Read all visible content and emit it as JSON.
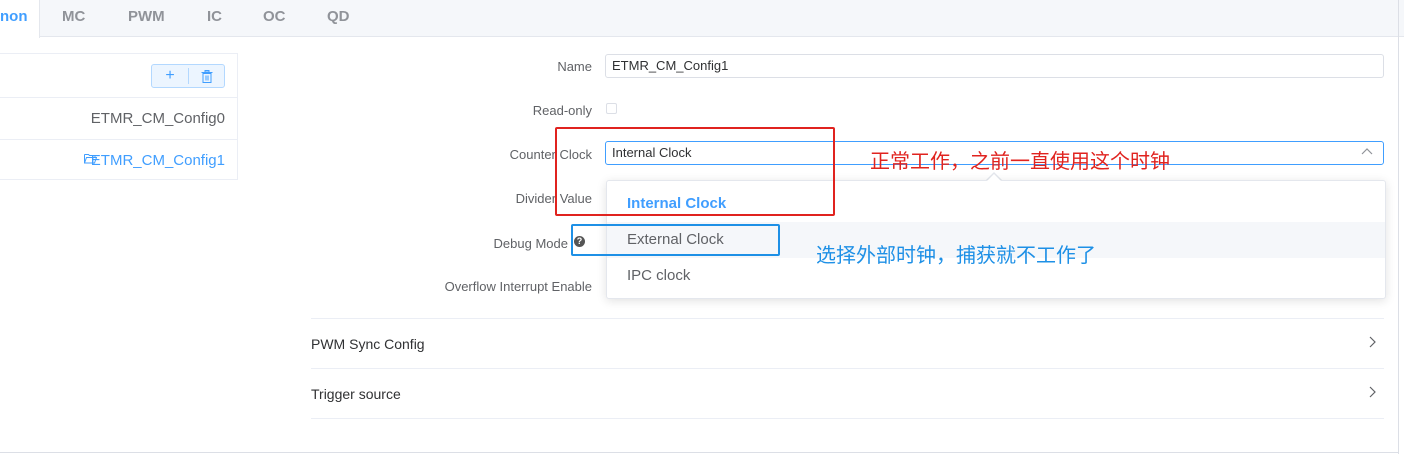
{
  "tabs": [
    {
      "label": "non",
      "active": true
    },
    {
      "label": "MC"
    },
    {
      "label": "PWM"
    },
    {
      "label": "IC"
    },
    {
      "label": "OC"
    },
    {
      "label": "QD"
    }
  ],
  "left": {
    "add_glyph": "+",
    "items": [
      {
        "label": "ETMR_CM_Config0"
      },
      {
        "label": "ETMR_CM_Config1",
        "selected": true
      }
    ]
  },
  "form": {
    "name_label": "Name",
    "name_value": "ETMR_CM_Config1",
    "readonly_label": "Read-only",
    "counter_clock_label": "Counter Clock",
    "counter_clock_value": "Internal Clock",
    "divider_label": "Divider Value",
    "debug_label": "Debug Mode",
    "help_glyph": "?",
    "overflow_label": "Overflow Interrupt Enable"
  },
  "dropdown": {
    "options": [
      {
        "label": "Internal Clock",
        "selected": true
      },
      {
        "label": "External Clock"
      },
      {
        "label": "IPC clock"
      }
    ]
  },
  "sections": [
    {
      "title": "PWM Sync Config"
    },
    {
      "title": "Trigger source"
    }
  ],
  "annotations": {
    "red_text": "正常工作，之前一直使用这个时钟",
    "blue_text": "选择外部时钟，捕获就不工作了"
  },
  "colors": {
    "accent": "#409eff",
    "annotation_red": "#e0231f",
    "annotation_blue": "#1e90e6"
  }
}
